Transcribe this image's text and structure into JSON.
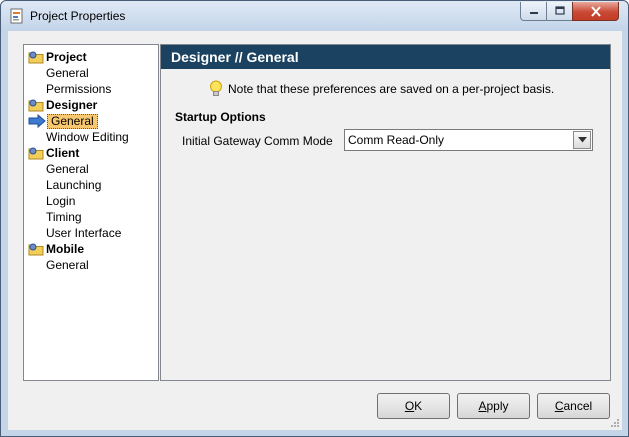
{
  "window": {
    "title": "Project Properties"
  },
  "tree": {
    "groups": [
      {
        "label": "Project",
        "items": [
          "General",
          "Permissions"
        ]
      },
      {
        "label": "Designer",
        "items": [
          "General",
          "Window Editing"
        ],
        "selected_index": 0
      },
      {
        "label": "Client",
        "items": [
          "General",
          "Launching",
          "Login",
          "Timing",
          "User Interface"
        ]
      },
      {
        "label": "Mobile",
        "items": [
          "General"
        ]
      }
    ]
  },
  "panel": {
    "header": "Designer // General",
    "note": "Note that these preferences are saved on a per-project basis.",
    "section_title": "Startup Options",
    "field_label": "Initial Gateway Comm Mode",
    "field_value": "Comm Read-Only"
  },
  "buttons": {
    "ok": {
      "mnemonic": "O",
      "rest": "K"
    },
    "apply": {
      "mnemonic": "A",
      "rest": "pply"
    },
    "cancel": {
      "mnemonic": "C",
      "rest": "ancel"
    }
  },
  "colors": {
    "header_bg": "#1b4260",
    "selection": "#f8c870",
    "titlebar": "#c3d4e9"
  },
  "icons": {
    "app": "project-properties-icon",
    "folder": "folder-gear-icon",
    "selection_arrow": "arrow-right-icon",
    "note": "lightbulb-icon"
  }
}
